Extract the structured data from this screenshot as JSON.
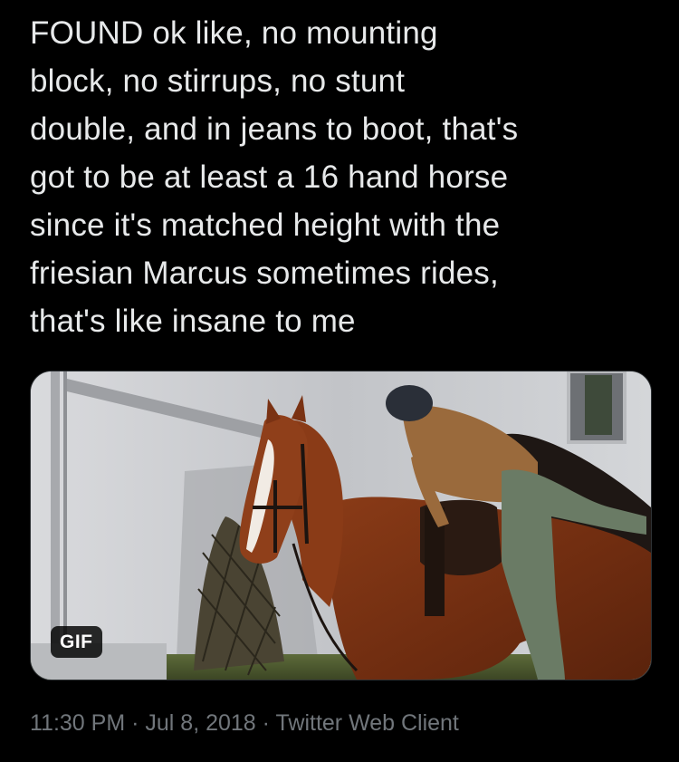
{
  "tweet": {
    "text_lines": [
      "FOUND ok like, no mounting",
      "block, no stirrups, no stunt",
      "double, and in jeans to boot, that's",
      "got to be at least a 16 hand horse",
      "since it's matched height with the",
      "friesian Marcus sometimes rides,",
      "that's like insane to me"
    ],
    "media": {
      "badge": "GIF",
      "icon": "animated-gif-media"
    },
    "time": "11:30 PM",
    "separator": "·",
    "date": "Jul 8, 2018",
    "source": "Twitter Web Client"
  },
  "colors": {
    "background": "#000000",
    "text": "#e7e9ea",
    "meta_text": "#71767b",
    "media_border": "#2f3336"
  }
}
